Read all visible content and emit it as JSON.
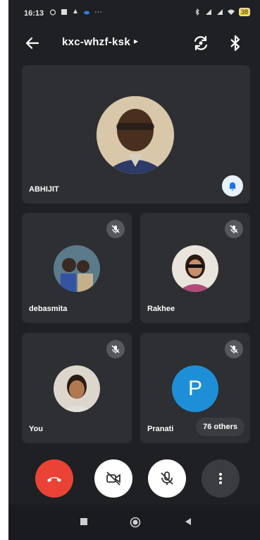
{
  "status_bar": {
    "time": "16:13",
    "battery": "38"
  },
  "app_bar": {
    "meeting_code": "kxc-whzf-ksk"
  },
  "participants": [
    {
      "name": "ABHIJIT"
    },
    {
      "name": "debasmita"
    },
    {
      "name": "Rakhee"
    },
    {
      "name": "You"
    },
    {
      "name": "Pranati",
      "initial": "P"
    }
  ],
  "others_label": "76 others",
  "colors": {
    "end_call": "#ea4335",
    "pranati_avatar": "#1e8fd6",
    "bell_icon": "#1a73e8"
  }
}
